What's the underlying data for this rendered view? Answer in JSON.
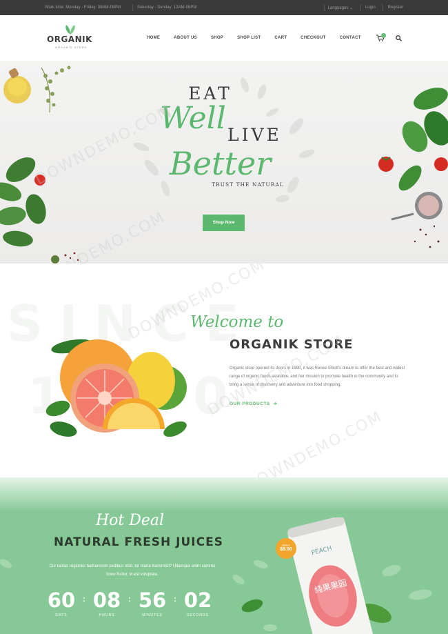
{
  "topbar": {
    "weekdays": "Work time: Monday - Friday: 08AM-06PM",
    "weekend": "Saturday - Sunday: 10AM-06PM",
    "languages": "Languages",
    "login": "Login",
    "register": "Register"
  },
  "header": {
    "brand": "ORGANIK",
    "brand_tagline": "ORGANIC STORE",
    "nav": [
      "HOME",
      "ABOUT US",
      "SHOP",
      "SHOP LIST",
      "CART",
      "CHECKOUT",
      "CONTACT"
    ],
    "cart_count": "0"
  },
  "hero": {
    "line1": "EAT",
    "line2": "Well",
    "line3": "LIVE",
    "line4": "Better",
    "tagline": "TRUST THE NATURAL",
    "cta": "Shop Now"
  },
  "about": {
    "script_title": "Welcome to",
    "title": "ORGANIK STORE",
    "background_word": "SINCE",
    "background_year": "1990",
    "text": "Organic store opened its doors in 1990, it was Renée Elliott's dream to offer the best and widest range of organic foods available, and her mission to promote health in the community and to bring a sense of discovery and adventure into food shopping.",
    "link": "OUR PRODUCTS"
  },
  "deal": {
    "script_title": "Hot Deal",
    "title": "NATURAL FRESH JUICES",
    "text": "Cur tantas regiones barbarorum pedibus obiit, tot maria transmisit? Ullamque enim summo bono fruitur, id est voluptate.",
    "countdown": [
      {
        "value": "60",
        "label": "DAYS"
      },
      {
        "value": "08",
        "label": "HOURS"
      },
      {
        "value": "56",
        "label": "MINUTES"
      },
      {
        "value": "02",
        "label": "SECONDS"
      }
    ],
    "badge_only": "ONLY",
    "badge_price": "$8.00",
    "can_brand": "PEACH",
    "can_text": "纯果果园"
  },
  "watermark": "DOWNDEMO.COM",
  "colors": {
    "accent": "#5cb86f",
    "dark": "#3b3b3b",
    "topbar": "#3a3a3a",
    "deal_bg": "#86c996",
    "badge": "#f1a62b"
  },
  "icons": [
    "leaf-logo-icon",
    "cart-icon",
    "search-icon",
    "arrow-right-icon"
  ]
}
